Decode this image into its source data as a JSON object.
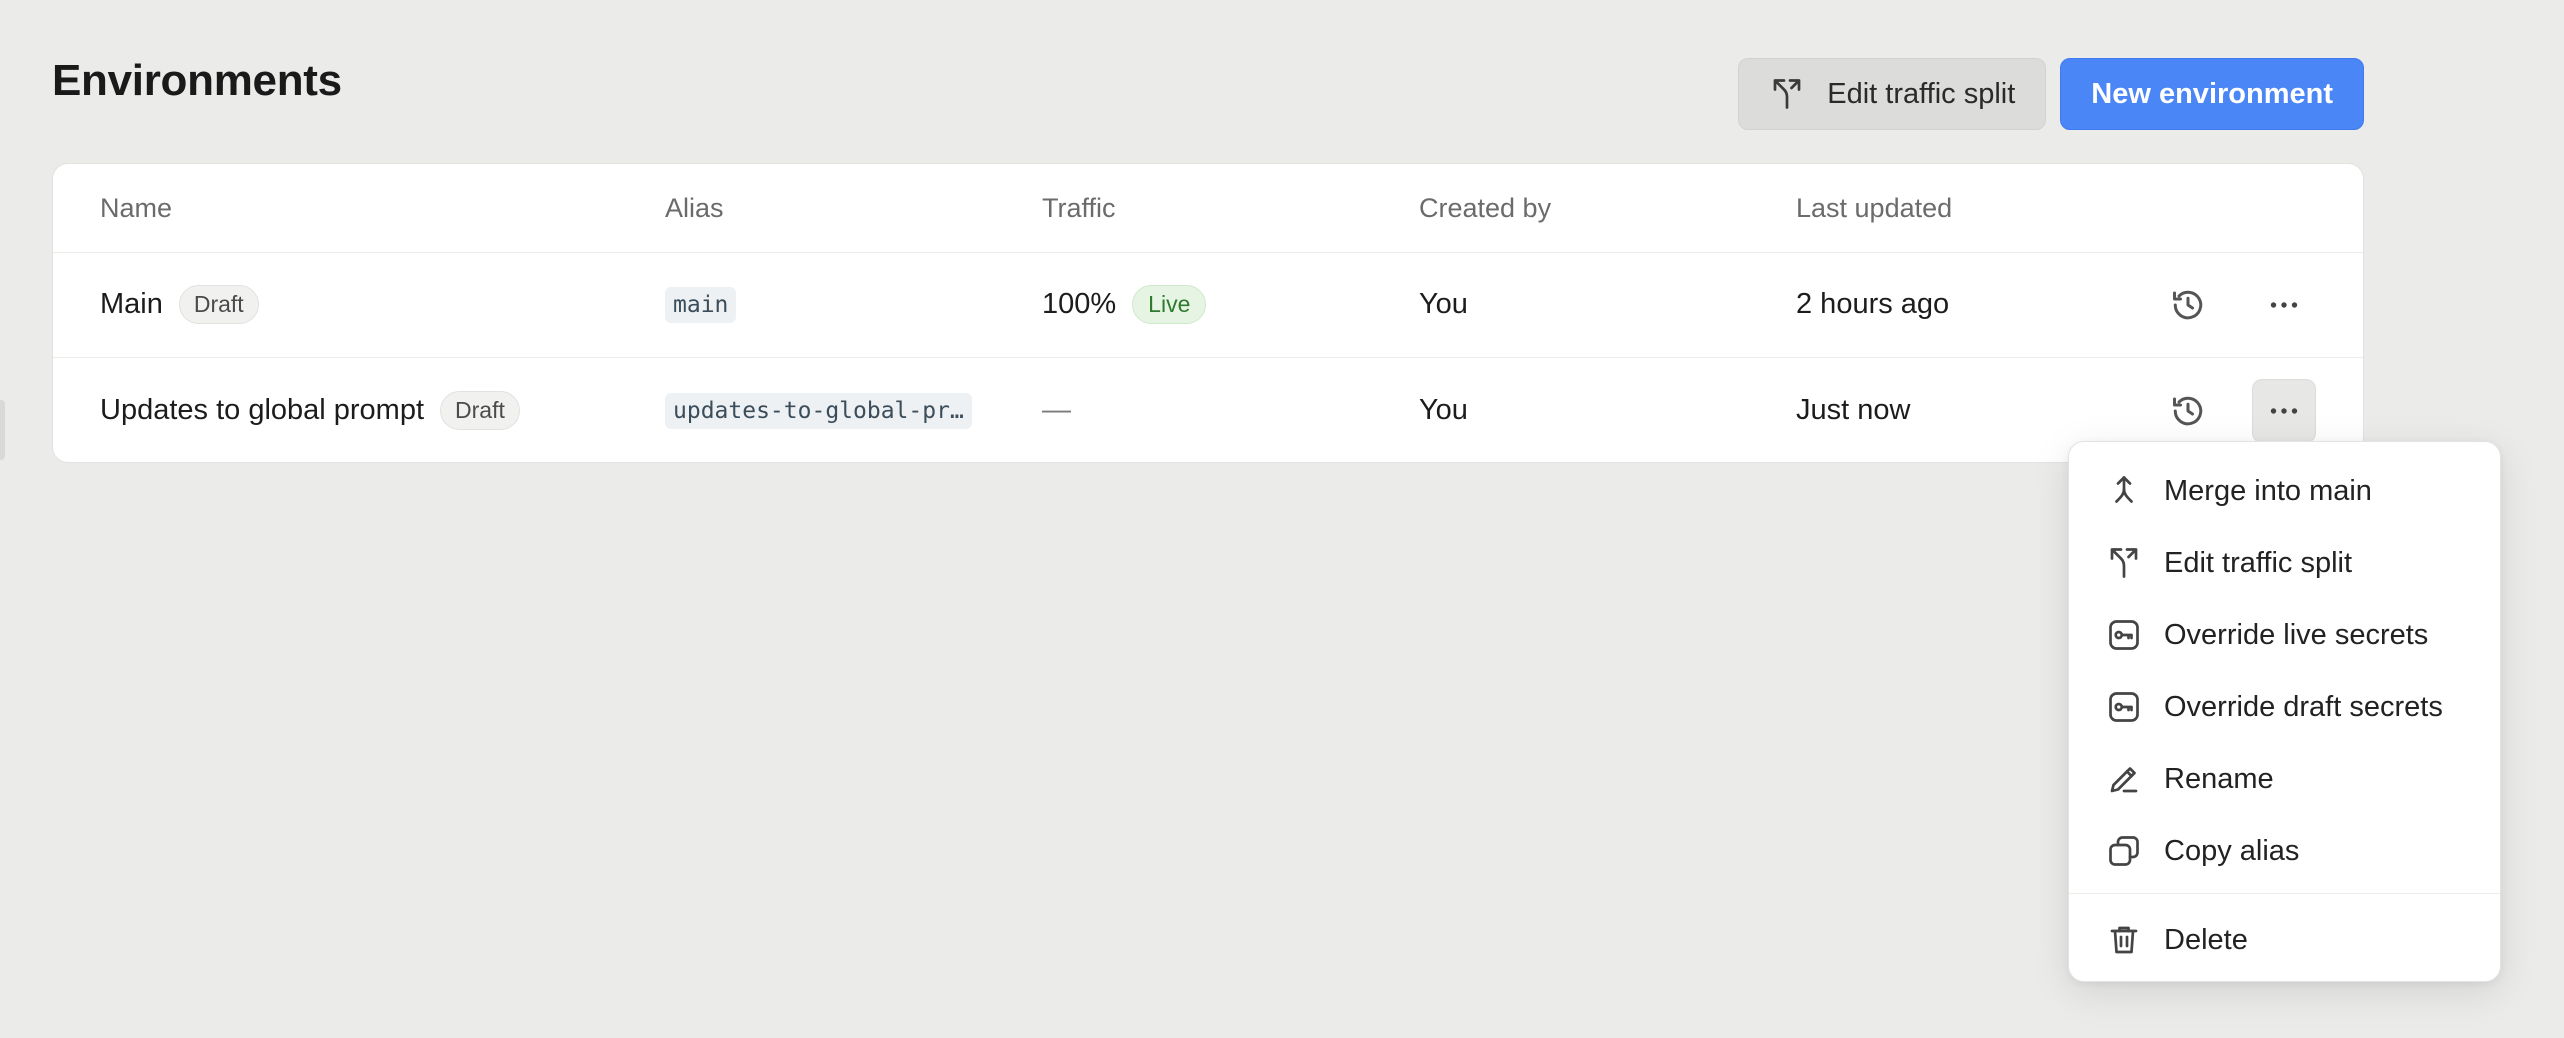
{
  "page": {
    "title": "Environments"
  },
  "header": {
    "edit_traffic_label": "Edit traffic split",
    "new_env_label": "New environment"
  },
  "table": {
    "columns": [
      "Name",
      "Alias",
      "Traffic",
      "Created by",
      "Last updated"
    ],
    "rows": [
      {
        "name": "Main",
        "badge": "Draft",
        "alias": "main",
        "traffic": "100%",
        "traffic_badge": "Live",
        "created_by": "You",
        "last_updated": "2 hours ago"
      },
      {
        "name": "Updates to global prompt",
        "badge": "Draft",
        "alias": "updates-to-global-pr…",
        "traffic": "—",
        "created_by": "You",
        "last_updated": "Just now"
      }
    ]
  },
  "menu": {
    "items": [
      {
        "label": "Merge into main",
        "icon": "merge-icon"
      },
      {
        "label": "Edit traffic split",
        "icon": "split-icon"
      },
      {
        "label": "Override live secrets",
        "icon": "key-icon"
      },
      {
        "label": "Override draft secrets",
        "icon": "key-icon"
      },
      {
        "label": "Rename",
        "icon": "pencil-icon"
      },
      {
        "label": "Copy alias",
        "icon": "copy-icon"
      },
      {
        "label": "Delete",
        "icon": "trash-icon"
      }
    ]
  },
  "colors": {
    "background": "#ebebea",
    "primary": "#4b86f7",
    "live_badge_bg": "#e6f5e3",
    "live_badge_text": "#2f7a2f"
  }
}
